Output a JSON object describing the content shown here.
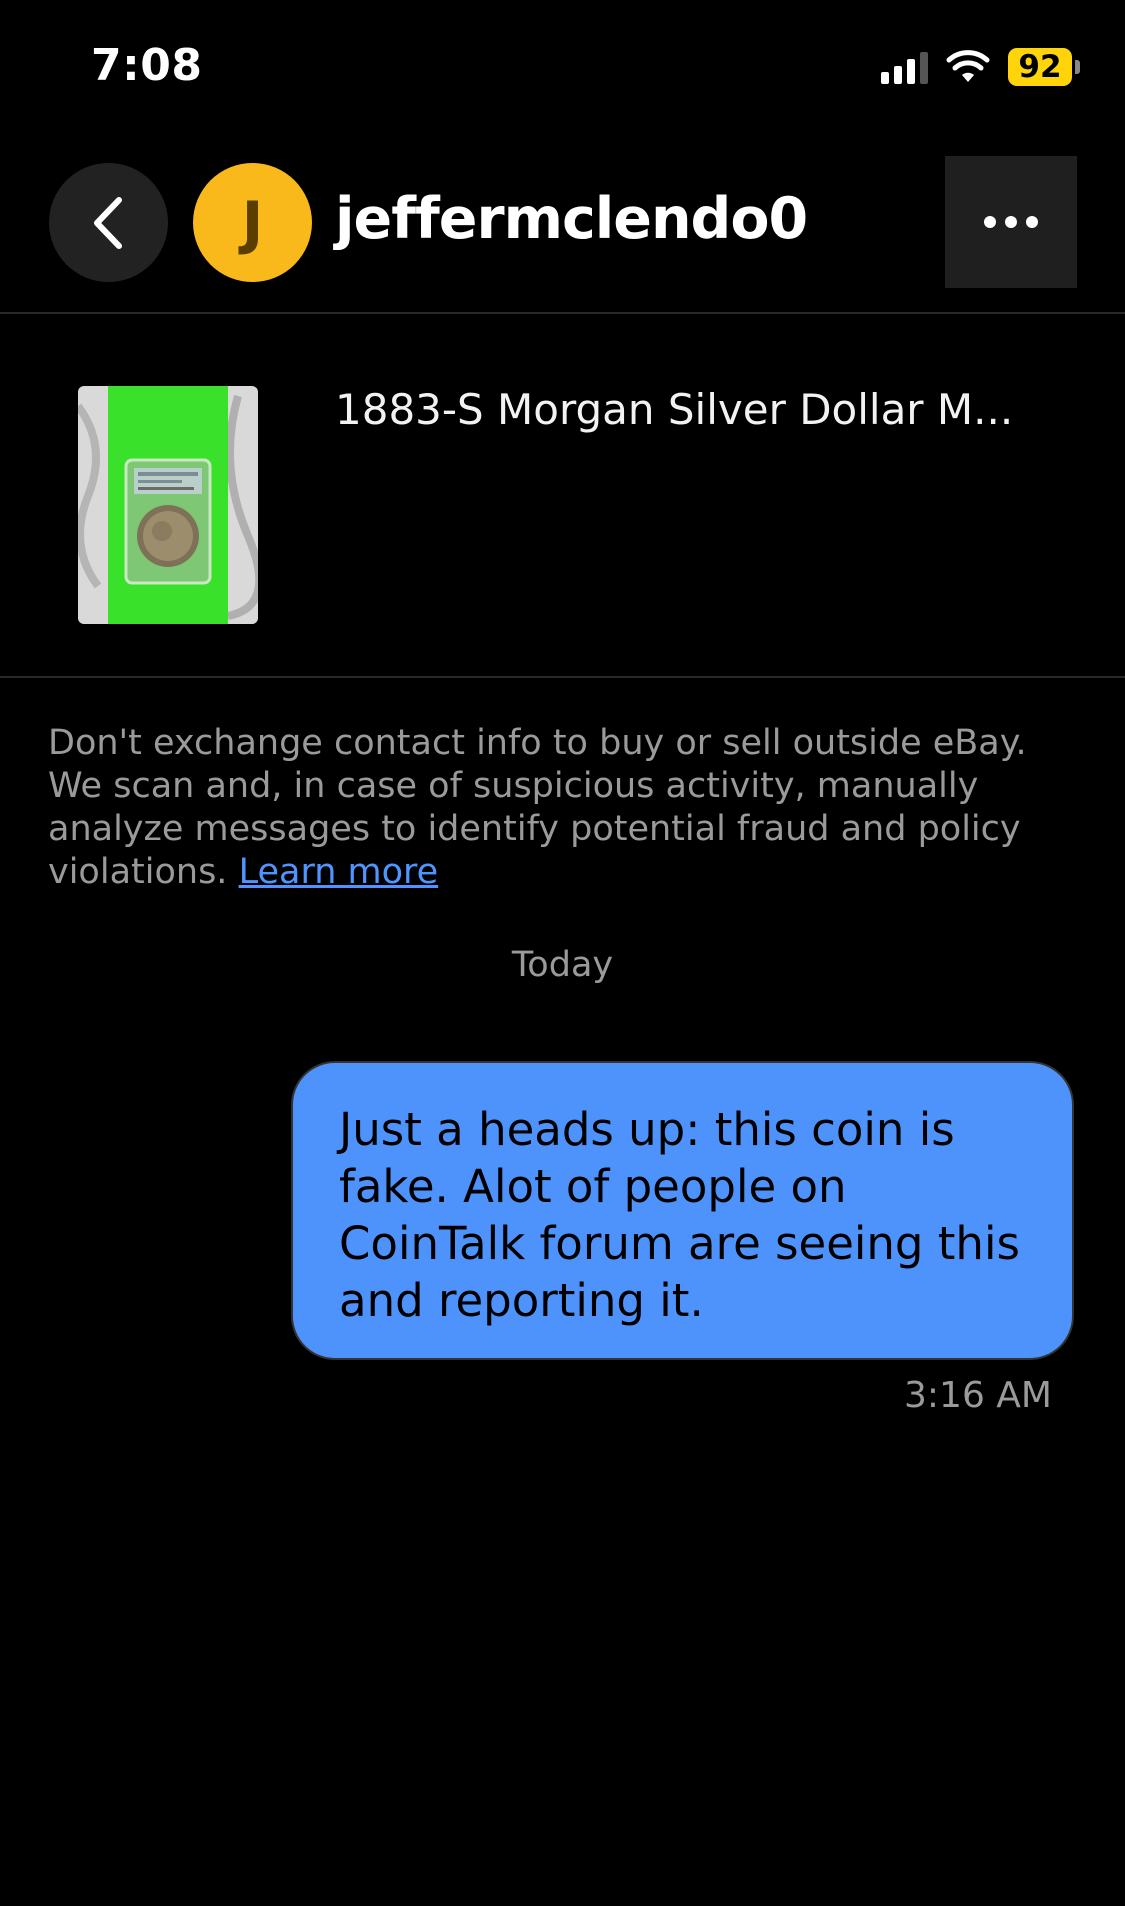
{
  "status_bar": {
    "time": "7:08",
    "battery": "92",
    "battery_color": "#ffd40a",
    "icons": [
      "cellular-signal-icon",
      "wifi-icon",
      "battery-icon"
    ]
  },
  "header": {
    "back_icon": "chevron-left-icon",
    "avatar_initial": "J",
    "avatar_color": "#f9b91b",
    "username": "jeffermclendo0",
    "more_icon": "ellipsis-icon"
  },
  "item": {
    "title": "1883-S Morgan Silver Dollar M..."
  },
  "notice": {
    "text": "Don't exchange contact info to buy or sell outside eBay. We scan and, in case of suspicious activity, manually analyze messages to identify potential fraud and policy violations.",
    "link": "Learn more"
  },
  "conversation": {
    "date_separator": "Today",
    "messages": [
      {
        "text": "Just a heads up: this coin is fake. Alot of people on CoinTalk forum are seeing this and reporting it.",
        "time": "3:16 AM",
        "bubble_color": "#4e93fb"
      }
    ]
  }
}
